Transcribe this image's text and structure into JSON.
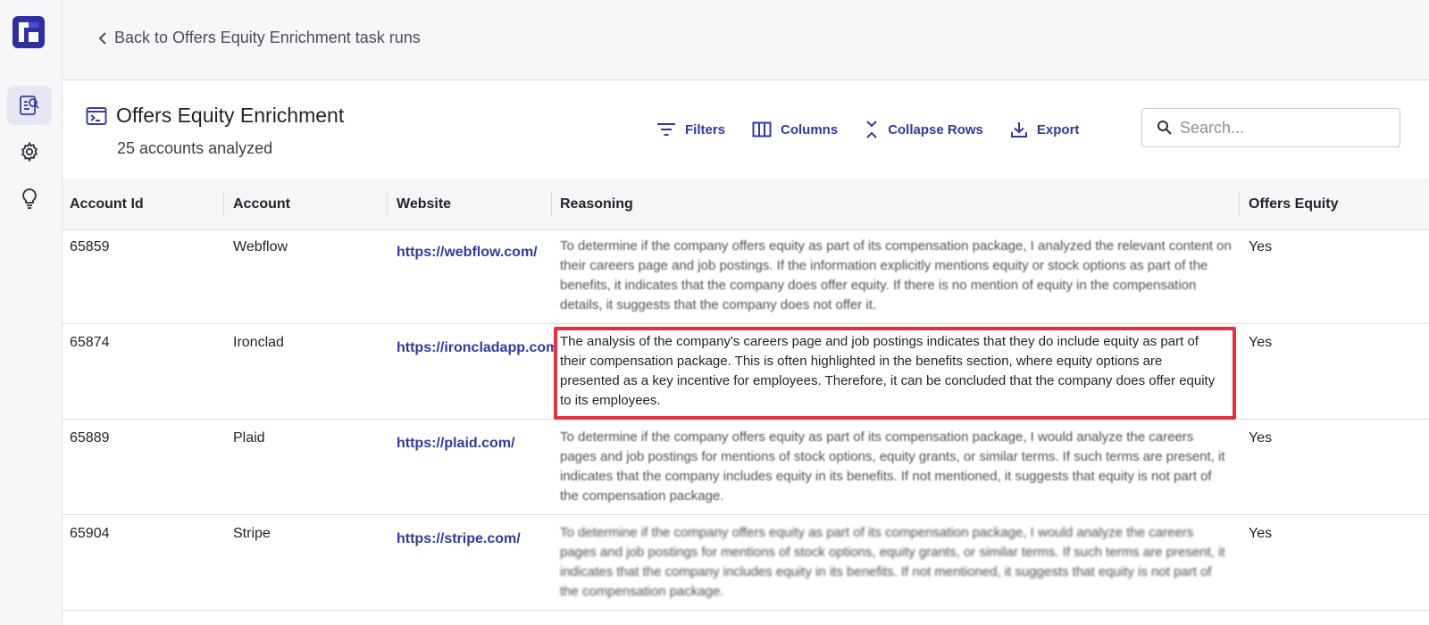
{
  "app": {
    "title": "Offers Equity Enrichment"
  },
  "sidebar": {
    "logo": "logo-mark",
    "items": [
      {
        "icon": "report-search-icon",
        "active": true
      },
      {
        "icon": "gear-icon",
        "active": false
      },
      {
        "icon": "lightbulb-icon",
        "active": false
      }
    ]
  },
  "topbar": {
    "back_label": "Back to Offers Equity Enrichment task runs"
  },
  "header": {
    "title": "Offers Equity Enrichment",
    "subtitle": "25 accounts analyzed",
    "toolbar": {
      "filters": "Filters",
      "columns": "Columns",
      "collapse_rows": "Collapse Rows",
      "export": "Export"
    },
    "search_placeholder": "Search..."
  },
  "table": {
    "columns": [
      "Account Id",
      "Account",
      "Website",
      "Reasoning",
      "Offers Equity"
    ],
    "rows": [
      {
        "account_id": "65859",
        "account": "Webflow",
        "website": "https://webflow.com/",
        "reasoning": "To determine if the company offers equity as part of its compensation package, I analyzed the relevant content on their careers page and job postings. If the information explicitly mentions equity or stock options as part of the benefits, it indicates that the company does offer equity. If there is no mention of equity in the compensation details, it suggests that the company does not offer it.",
        "offers_equity": "Yes"
      },
      {
        "account_id": "65874",
        "account": "Ironclad",
        "website": "https://ironcladapp.com/",
        "reasoning": "The analysis of the company's careers page and job postings indicates that they do include equity as part of their compensation package. This is often highlighted in the benefits section, where equity options are presented as a key incentive for employees. Therefore, it can be concluded that the company does offer equity to its employees.",
        "offers_equity": "Yes"
      },
      {
        "account_id": "65889",
        "account": "Plaid",
        "website": "https://plaid.com/",
        "reasoning": "To determine if the company offers equity as part of its compensation package, I would analyze the careers pages and job postings for mentions of stock options, equity grants, or similar terms. If such terms are present, it indicates that the company includes equity in its benefits. If not mentioned, it suggests that equity is not part of the compensation package.",
        "offers_equity": "Yes"
      },
      {
        "account_id": "65904",
        "account": "Stripe",
        "website": "https://stripe.com/",
        "reasoning": "To determine if the company offers equity as part of its compensation package, I would analyze the careers pages and job postings for mentions of stock options, equity grants, or similar terms. If such terms are present, it indicates that the company includes equity in its benefits. If not mentioned, it suggests that equity is not part of the compensation package.",
        "offers_equity": "Yes"
      }
    ]
  },
  "colors": {
    "accent": "#2f3a9e",
    "highlight": "#e5303e",
    "sidebar_bg": "#f7f7f9"
  }
}
